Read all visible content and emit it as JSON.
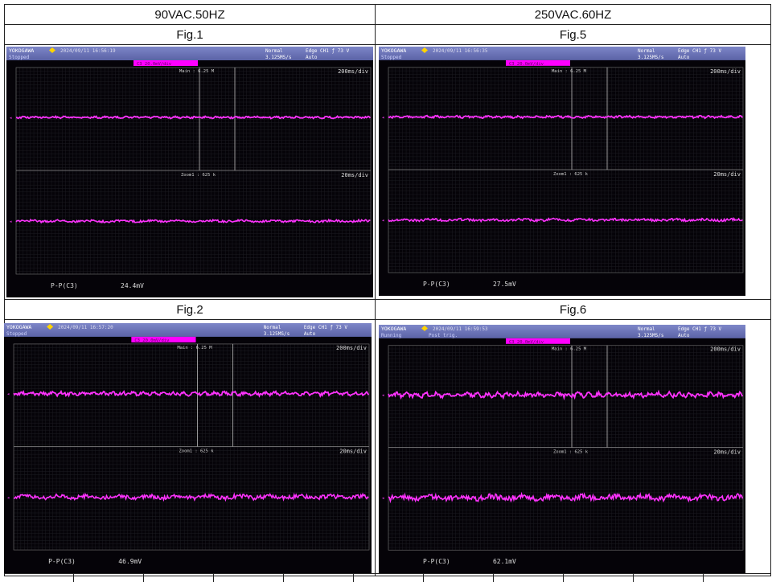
{
  "headers": [
    "90VAC.50HZ",
    "250VAC.60HZ"
  ],
  "figures": [
    {
      "label": "Fig.1",
      "brand": "YOKOGAWA",
      "timestamp": "2024/09/11 16:56:19",
      "state": "Stopped",
      "trig_mode": "Normal",
      "sample_rate": "3.125MS/s",
      "trigger": "Edge CH1 ƒ 73 V",
      "auto": "Auto",
      "channel": "C3 20.0mV/div",
      "main": "Main : 6.25 M",
      "main_div": "200ms/div",
      "zoom": "Zoom1 : 625 k",
      "zoom_div": "20ms/div",
      "meas_label": "P-P(C3)",
      "meas_value": "24.4mV",
      "pp_mv": 24.4
    },
    {
      "label": "Fig.5",
      "brand": "YOKOGAWA",
      "timestamp": "2024/09/11 16:56:35",
      "state": "Stopped",
      "trig_mode": "Normal",
      "sample_rate": "3.125MS/s",
      "trigger": "Edge CH1 ƒ 73 V",
      "auto": "Auto",
      "channel": "C3 20.0mV/div",
      "main": "Main : 6.25 M",
      "main_div": "200ms/div",
      "zoom": "Zoom1 : 625 k",
      "zoom_div": "20ms/div",
      "meas_label": "P-P(C3)",
      "meas_value": "27.5mV",
      "pp_mv": 27.5
    },
    {
      "label": "Fig.2",
      "brand": "YOKOGAWA",
      "timestamp": "2024/09/11 16:57:20",
      "state": "Stopped",
      "trig_mode": "Normal",
      "sample_rate": "3.125MS/s",
      "trigger": "Edge CH1 ƒ 73 V",
      "auto": "Auto",
      "channel": "C3 20.0mV/div",
      "main": "Main : 6.25 M",
      "main_div": "200ms/div",
      "zoom": "Zoom1 : 625 k",
      "zoom_div": "20ms/div",
      "meas_label": "P-P(C3)",
      "meas_value": "46.9mV",
      "pp_mv": 46.9
    },
    {
      "label": "Fig.6",
      "brand": "YOKOGAWA",
      "timestamp": "2024/09/11 16:59:53",
      "state": "Running",
      "trig_mode": "Normal",
      "sample_rate": "3.125MS/s",
      "trigger": "Edge CH1 ƒ 73 V",
      "auto": "Auto",
      "channel": "C3 20.0mV/div",
      "main": "Main : 6.25 M",
      "main_div": "200ms/div",
      "zoom": "Zoom1 : 625 k",
      "zoom_div": "20ms/div",
      "meas_label": "P-P(C3)",
      "meas_value": "62.1mV",
      "pp_mv": 62.1,
      "post_trig": "Post trig."
    }
  ],
  "colors": {
    "trace": "#ff33ff",
    "header": "#5b63a6",
    "label": "#ff00ff"
  }
}
